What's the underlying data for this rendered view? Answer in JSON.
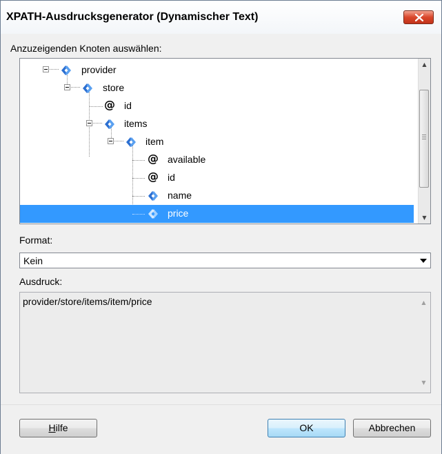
{
  "window": {
    "title": "XPATH-Ausdrucksgenerator (Dynamischer Text)"
  },
  "tree": {
    "label": "Anzuzeigenden Knoten auswählen:",
    "nodes": [
      {
        "text": "provider",
        "type": "element",
        "expanded": true
      },
      {
        "text": "store",
        "type": "element",
        "expanded": true
      },
      {
        "text": "id",
        "type": "attribute"
      },
      {
        "text": "items",
        "type": "element",
        "expanded": true
      },
      {
        "text": "item",
        "type": "element",
        "expanded": true
      },
      {
        "text": "available",
        "type": "attribute"
      },
      {
        "text": "id",
        "type": "attribute"
      },
      {
        "text": "name",
        "type": "element"
      },
      {
        "text": "price",
        "type": "element",
        "selected": true
      }
    ]
  },
  "format": {
    "label": "Format:",
    "value": "Kein"
  },
  "expression": {
    "label": "Ausdruck:",
    "value": "provider/store/items/item/price"
  },
  "buttons": {
    "help_mnemonic": "H",
    "help_rest": "ilfe",
    "ok": "OK",
    "cancel": "Abbrechen"
  },
  "colors": {
    "selection": "#3399ff",
    "element_icon": "#2c6fd1",
    "close_button": "#d9472b"
  },
  "icons": {
    "element": "xml-element-icon",
    "attribute": "at-sign-icon",
    "close": "close-x-icon"
  }
}
